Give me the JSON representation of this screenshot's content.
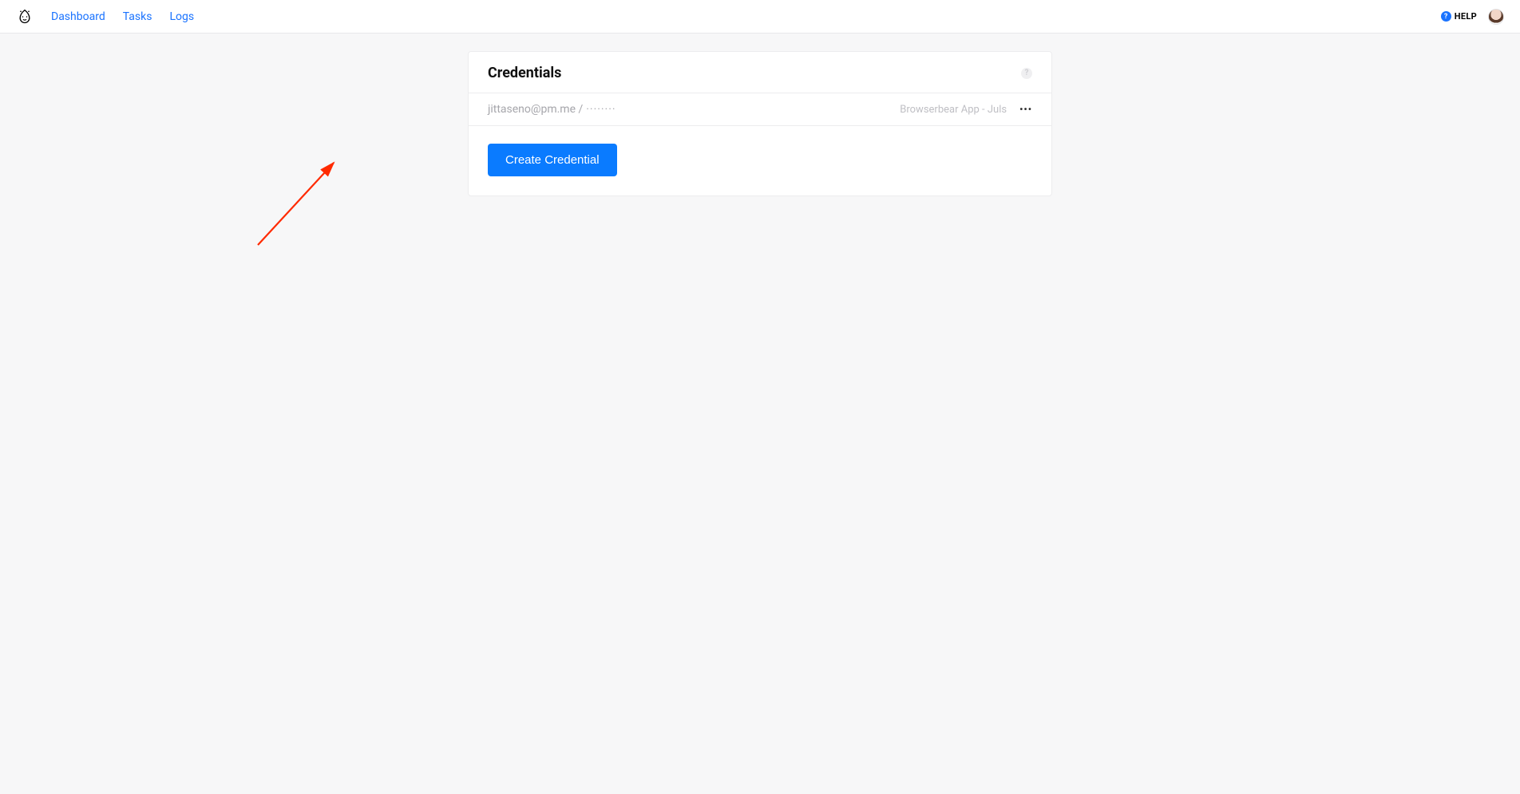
{
  "nav": {
    "links": [
      "Dashboard",
      "Tasks",
      "Logs"
    ],
    "help_label": "HELP"
  },
  "card": {
    "title": "Credentials",
    "credential": {
      "identity": "jittaseno@pm.me /",
      "masked": "········",
      "app_label": "Browserbear App - Juls"
    },
    "create_button": "Create Credential"
  }
}
